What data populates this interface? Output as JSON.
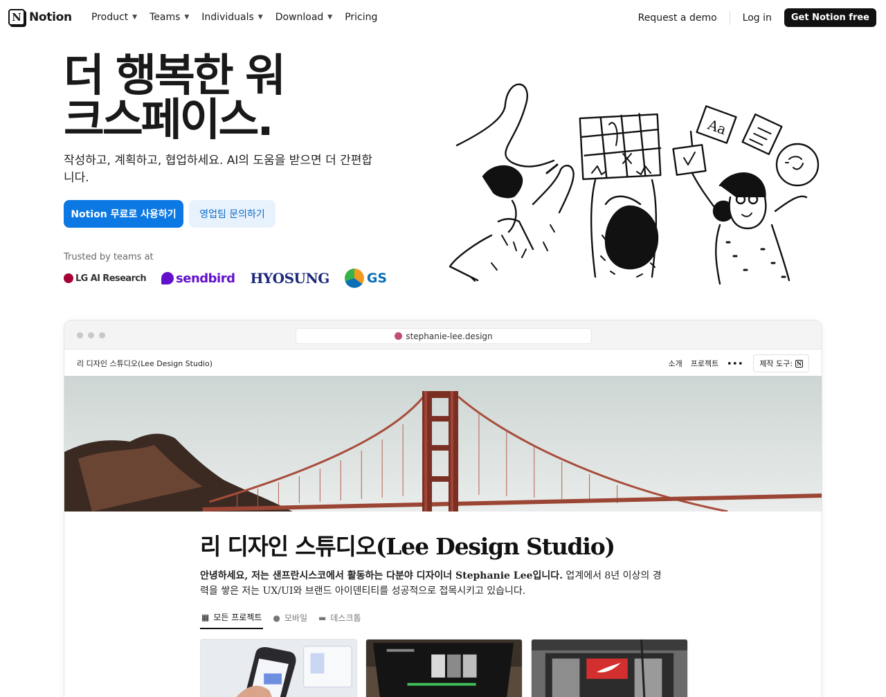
{
  "nav": {
    "brand": "Notion",
    "brand_logo": "N",
    "links": [
      {
        "label": "Product",
        "dropdown": true
      },
      {
        "label": "Teams",
        "dropdown": true
      },
      {
        "label": "Individuals",
        "dropdown": true
      },
      {
        "label": "Download",
        "dropdown": true
      },
      {
        "label": "Pricing",
        "dropdown": false
      }
    ],
    "request_demo": "Request a demo",
    "login": "Log in",
    "cta": "Get Notion free"
  },
  "hero": {
    "title": "더 행복한 워크스페이스.",
    "subtitle": "작성하고, 계획하고, 협업하세요. AI의 도움을 받으면 더 간편합니다.",
    "primary_button": "Notion 무료로 사용하기",
    "secondary_button": "영업팀 문의하기",
    "trusted": "Trusted by teams at",
    "logos": {
      "lg": "LG AI Research",
      "sendbird": "sendbird",
      "hyosung": "HYOSUNG",
      "gs": "GS"
    }
  },
  "browser": {
    "url": "stephanie-lee.design",
    "site_name": "리 디자인 스튜디오(Lee Design Studio)",
    "menu": [
      "소개",
      "프로젝트"
    ],
    "more": "•••",
    "made_with": "제작 도구:",
    "made_with_logo": "N",
    "page_title": "리 디자인 스튜디오(Lee Design Studio)",
    "intro_bold": "안녕하세요, 저는 샌프란시스코에서 활동하는 다분야 디자이너 Stephanie Lee입니다.",
    "intro_rest": " 업계에서 8년 이상의 경력을 쌓은 저는 UX/UI와 브랜드 아이덴티티를 성공적으로 접목시키고 있습니다.",
    "tabs": [
      {
        "label": "모든 프로젝트",
        "icon": "grid-icon",
        "active": true
      },
      {
        "label": "모바일",
        "icon": "mobile-icon",
        "active": false
      },
      {
        "label": "데스크톱",
        "icon": "desktop-icon",
        "active": false
      }
    ]
  },
  "colors": {
    "primary": "#0b78e3",
    "primary_soft": "#e8f2fd",
    "cta_dark": "#111111",
    "bridge": "#b4533f"
  }
}
